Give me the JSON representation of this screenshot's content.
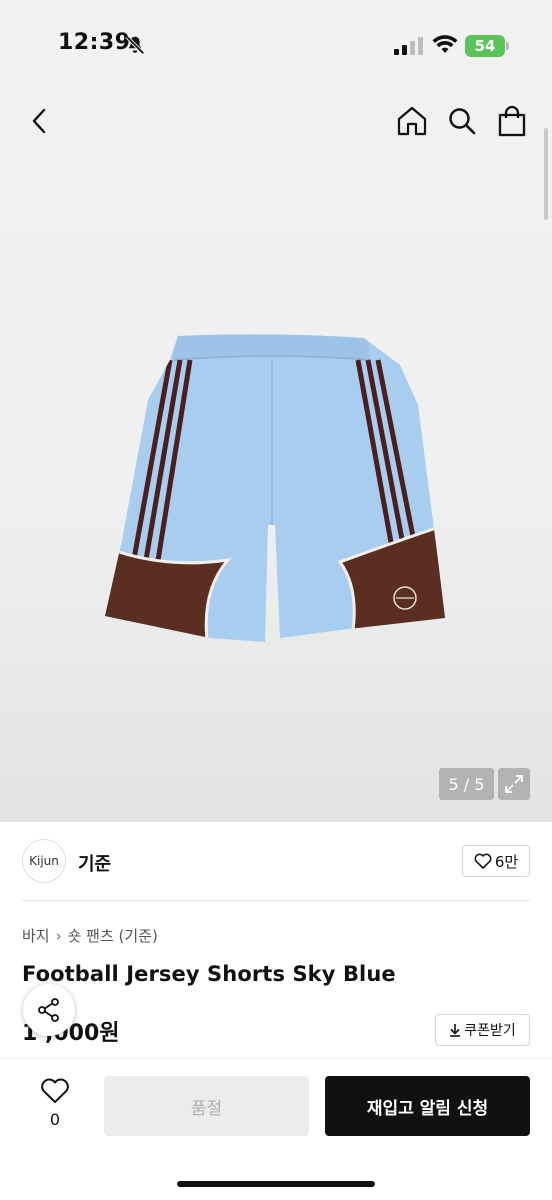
{
  "status_bar": {
    "time": "12:39",
    "battery": "54"
  },
  "nav": {
    "back_icon": "chevron-left-icon",
    "home_icon": "home-icon",
    "search_icon": "search-icon",
    "bag_icon": "shopping-bag-icon"
  },
  "gallery": {
    "counter": "5 / 5",
    "expand_icon": "expand-icon",
    "shorts_colors": {
      "body": "#a9cdef",
      "panel": "#5a2f22",
      "stripes": "#4a1f1f"
    }
  },
  "brand": {
    "logo_text": "Kijun",
    "name": "기준",
    "likes": "6만"
  },
  "breadcrumb": {
    "category": "바지",
    "subcategory": "숏 팬츠 (기준)"
  },
  "product": {
    "title": "Football Jersey Shorts Sky Blue",
    "price": "1  ,000원",
    "coupon_label": "쿠폰받기"
  },
  "bottom_bar": {
    "wish_count": "0",
    "soldout_label": "품절",
    "restock_label": "재입고 알림 신청"
  }
}
